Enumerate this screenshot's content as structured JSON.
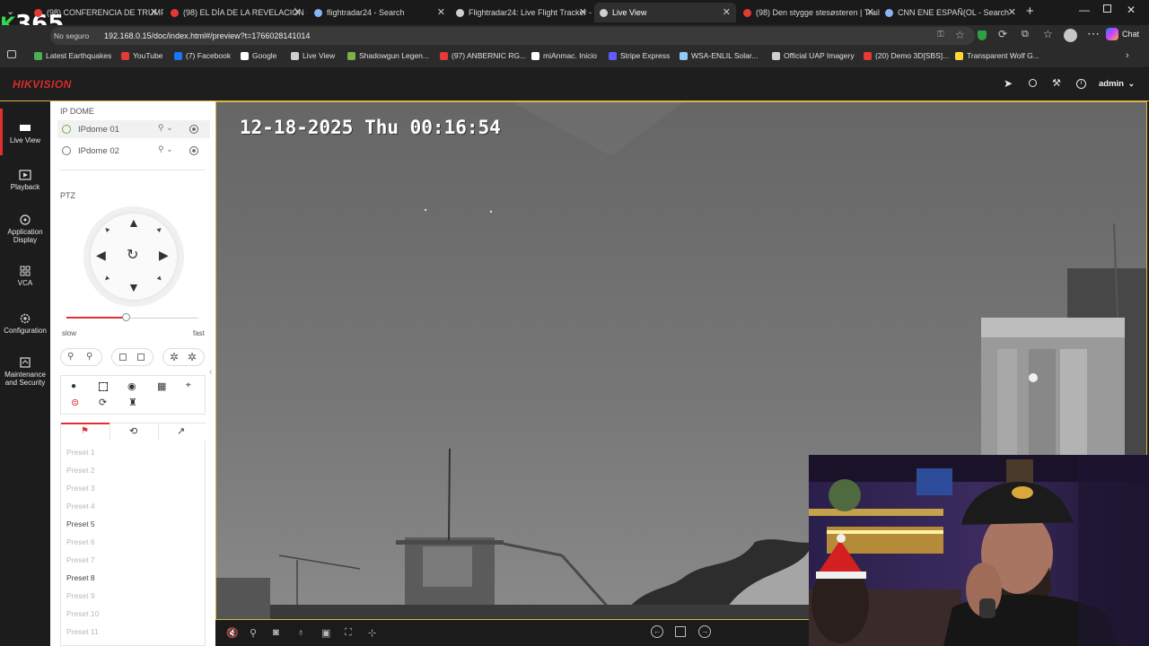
{
  "overlay_badge": "365",
  "tabs": [
    {
      "label": "(98) CONFERENCIA DE TRUMP",
      "favicon_color": "#e53935"
    },
    {
      "label": "(98) EL DÍA DE LA REVELACIÓN - ",
      "favicon_color": "#e53935"
    },
    {
      "label": "flightradar24 - Search",
      "favicon_color": "#8ab4f8"
    },
    {
      "label": "Flightradar24: Live Flight Tracker - ",
      "favicon_color": "#cfcfcf"
    },
    {
      "label": "Live View",
      "favicon_color": "#cfcfcf"
    },
    {
      "label": "(98) Den stygge stesøsteren | Trail",
      "favicon_color": "#e53935"
    },
    {
      "label": "CNN ENE ESPAÑ(OL - Search",
      "favicon_color": "#8ab4f8"
    }
  ],
  "address": {
    "security": "No seguro",
    "url": "192.168.0.15/doc/index.html#/preview?t=1766028141014",
    "chat_label": "Chat"
  },
  "bookmarks": [
    {
      "label": "Latest Earthquakes",
      "color": "#4caf50"
    },
    {
      "label": "YouTube",
      "color": "#e53935"
    },
    {
      "label": "(7) Facebook",
      "color": "#1877f2"
    },
    {
      "label": "Google",
      "color": "#ffffff"
    },
    {
      "label": "Live View",
      "color": "#cfcfcf"
    },
    {
      "label": "Shadowgun Legen...",
      "color": "#7cb342"
    },
    {
      "label": "(97) ANBERNIC RG...",
      "color": "#e53935"
    },
    {
      "label": "miAnmac. Inicio",
      "color": "#ffffff"
    },
    {
      "label": "Stripe Express",
      "color": "#635bff"
    },
    {
      "label": "WSA-ENLIL Solar...",
      "color": "#90caf9"
    },
    {
      "label": "Official UAP Imagery",
      "color": "#cfcfcf"
    },
    {
      "label": "(20) Demo 3D[SBS]...",
      "color": "#e53935"
    },
    {
      "label": "Transparent Wolf G...",
      "color": "#fdd835"
    }
  ],
  "header": {
    "brand": "HIKVISION",
    "user": "admin"
  },
  "nav": [
    {
      "label": "Live View",
      "icon": "live-view-icon"
    },
    {
      "label": "Playback",
      "icon": "playback-icon"
    },
    {
      "label": "Application Display",
      "icon": "application-display-icon"
    },
    {
      "label": "VCA",
      "icon": "vca-icon"
    },
    {
      "label": "Configuration",
      "icon": "gear-icon"
    },
    {
      "label": "Maintenance and Security",
      "icon": "maintenance-icon"
    }
  ],
  "panel": {
    "group_title": "IP DOME",
    "cameras": [
      "IPdome 01",
      "IPdome 02"
    ],
    "ptz_title": "PTZ",
    "speed_slow": "slow",
    "speed_fast": "fast",
    "speed_level": 0.45,
    "presets": [
      {
        "label": "Preset 1",
        "set": false
      },
      {
        "label": "Preset 2",
        "set": false
      },
      {
        "label": "Preset 3",
        "set": false
      },
      {
        "label": "Preset 4",
        "set": false
      },
      {
        "label": "Preset 5",
        "set": true
      },
      {
        "label": "Preset 6",
        "set": false
      },
      {
        "label": "Preset 7",
        "set": false
      },
      {
        "label": "Preset 8",
        "set": true
      },
      {
        "label": "Preset 9",
        "set": false
      },
      {
        "label": "Preset 10",
        "set": false
      },
      {
        "label": "Preset 11",
        "set": false
      }
    ]
  },
  "video": {
    "osd_timestamp": "12-18-2025 Thu 00:16:54"
  },
  "colors": {
    "accent_red": "#e0312f",
    "video_border": "#d7b64a"
  }
}
